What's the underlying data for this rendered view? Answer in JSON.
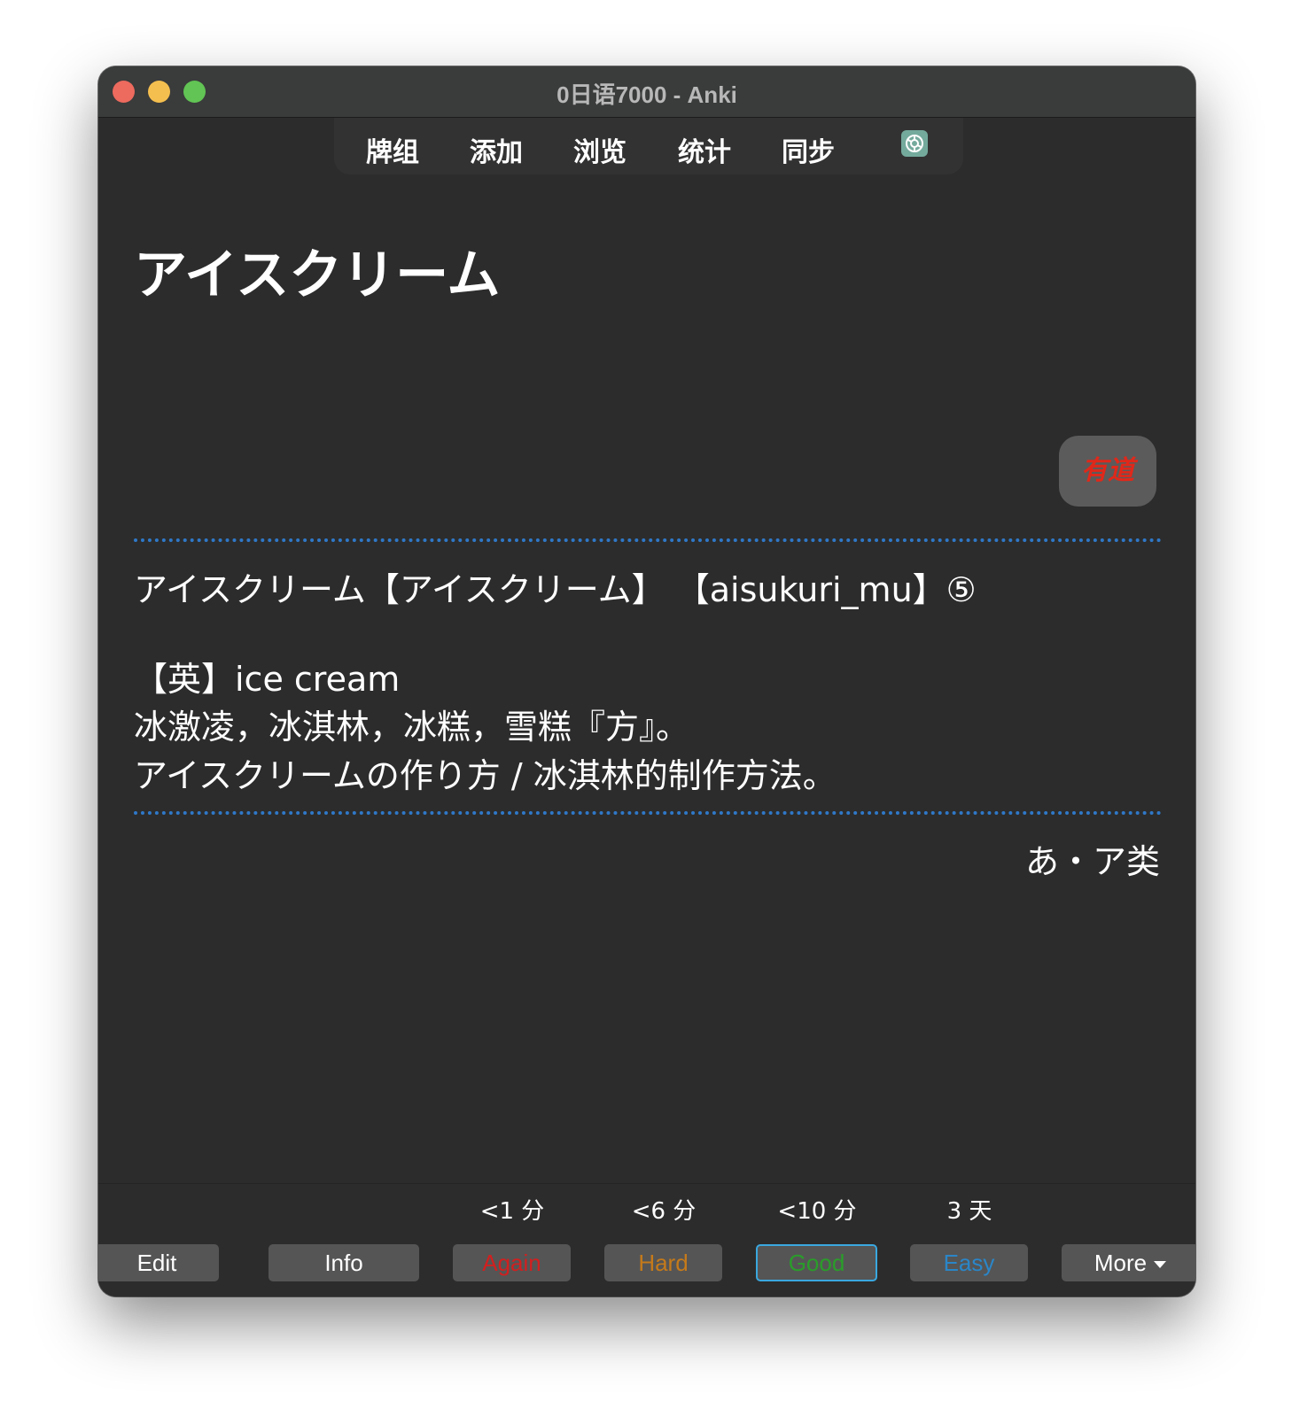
{
  "window": {
    "title": "0日语7000 - Anki"
  },
  "toolbar": {
    "items": [
      "牌组",
      "添加",
      "浏览",
      "统计",
      "同步"
    ],
    "extra_icon": "chatgpt-icon"
  },
  "card": {
    "front_word": "アイスクリーム",
    "youdao_label": "有道",
    "reading_line": "アイスクリーム【アイスクリーム】 【aisukuri_mu】⑤",
    "english_line": "【英】ice cream",
    "meaning_line": "冰激凌，冰淇林，冰糕，雪糕『方』。",
    "example_line": "アイスクリームの作り方 / 冰淇林的制作方法。",
    "category": "あ・ア类"
  },
  "review": {
    "intervals": {
      "again": "<1 分",
      "hard": "<6 分",
      "good": "<10 分",
      "easy": "3 天"
    },
    "buttons": {
      "edit": "Edit",
      "info": "Info",
      "again": "Again",
      "hard": "Hard",
      "good": "Good",
      "easy": "Easy",
      "more": "More"
    }
  },
  "colors": {
    "again": "#d21f1f",
    "hard": "#c57a1a",
    "good": "#2a9d2a",
    "easy": "#2a86c8",
    "separator": "#2f78c8",
    "youdao": "#e0281a"
  }
}
